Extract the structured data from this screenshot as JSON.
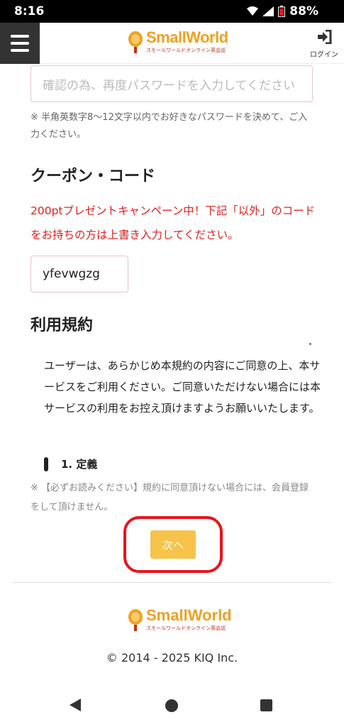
{
  "status_bar": {
    "time": "8:16",
    "battery": "88%",
    "icons": [
      "wifi-icon",
      "signal-icon",
      "battery-icon"
    ]
  },
  "header": {
    "menu_icon": "hamburger-menu-icon",
    "brand": "SmallWorld",
    "brand_sub": "スモールワールドオンライン英会話",
    "login_label": "ログイン",
    "login_icon": "login-icon"
  },
  "password_confirm": {
    "placeholder": "確認の為、再度パスワードを入力してください",
    "note": "※ 半角英数字8～12文字以内でお好きなパスワードを決めて、ご入力ください。"
  },
  "coupon": {
    "title": "クーポン・コード",
    "promo": "200ptプレゼントキャンペーン中！下記「以外」のコードをお持ちの方は上書き入力してください。",
    "value": "yfevwgzg"
  },
  "terms": {
    "title": "利用規約",
    "body": "ユーザーは、あらかじめ本規約の内容にご同意の上、本サービスをご利用ください。ご同意いただけない場合には本サービスの利用をお控え頂けますようお願いいたします。",
    "section_title": "1. 定義",
    "note": "※ 【必ずお読みください】規約に同意頂けない場合には、会員登録をして頂けません。"
  },
  "next_button": {
    "label": "次へ"
  },
  "footer": {
    "brand": "SmallWorld",
    "brand_sub": "スモールワールドオンライン英会話",
    "copyright": "© 2014 - 2025 KIQ Inc."
  },
  "colors": {
    "accent": "#f7c34a",
    "brand_orange": "#f0a020",
    "promo_red": "#e02020",
    "highlight_red": "#e8141c"
  }
}
